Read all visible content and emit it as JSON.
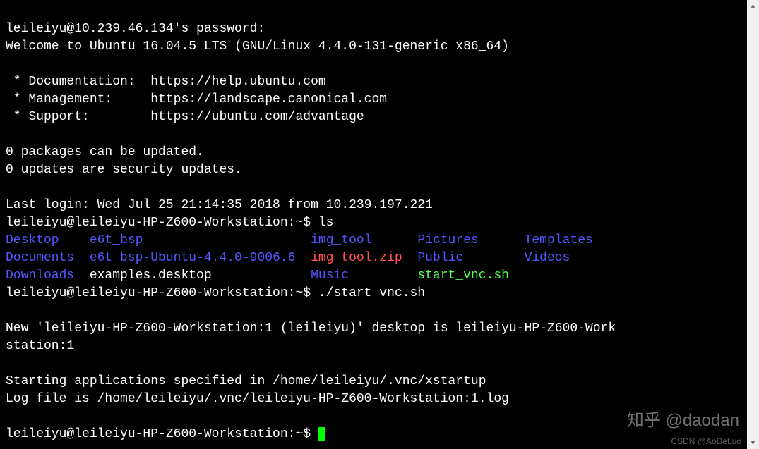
{
  "lines": {
    "l0": "leileiyu@10.239.46.134's password:",
    "l1": "Welcome to Ubuntu 16.04.5 LTS (GNU/Linux 4.4.0-131-generic x86_64)",
    "l2": "",
    "l3": " * Documentation:  https://help.ubuntu.com",
    "l4": " * Management:     https://landscape.canonical.com",
    "l5": " * Support:        https://ubuntu.com/advantage",
    "l6": "",
    "l7": "0 packages can be updated.",
    "l8": "0 updates are security updates.",
    "l9": "",
    "l10": "Last login: Wed Jul 25 21:14:35 2018 from 10.239.197.221"
  },
  "prompt1": "leileiyu@leileiyu-HP-Z600-Workstation:~$ ",
  "cmd1": "ls",
  "ls": {
    "r1c1": "Desktop",
    "r1c2": "e6t_bsp",
    "r1c3": "img_tool",
    "r1c4": "Pictures",
    "r1c5": "Templates",
    "r2c1": "Documents",
    "r2c2": "e6t_bsp-Ubuntu-4.4.0-9006.6",
    "r2c3": "img_tool.zip",
    "r2c4": "Public",
    "r2c5": "Videos",
    "r3c1": "Downloads",
    "r3c2": "examples.desktop",
    "r3c3": "Music",
    "r3c4": "start_vnc.sh"
  },
  "prompt2": "leileiyu@leileiyu-HP-Z600-Workstation:~$ ",
  "cmd2": "./start_vnc.sh",
  "out": {
    "o0": "",
    "o1": "New 'leileiyu-HP-Z600-Workstation:1 (leileiyu)' desktop is leileiyu-HP-Z600-Work",
    "o2": "station:1",
    "o3": "",
    "o4": "Starting applications specified in /home/leileiyu/.vnc/xstartup",
    "o5": "Log file is /home/leileiyu/.vnc/leileiyu-HP-Z600-Workstation:1.log",
    "o6": ""
  },
  "prompt3": "leileiyu@leileiyu-HP-Z600-Workstation:~$ ",
  "watermark1": "知乎 @daodan",
  "watermark2": "CSDN @AoDeLuo"
}
